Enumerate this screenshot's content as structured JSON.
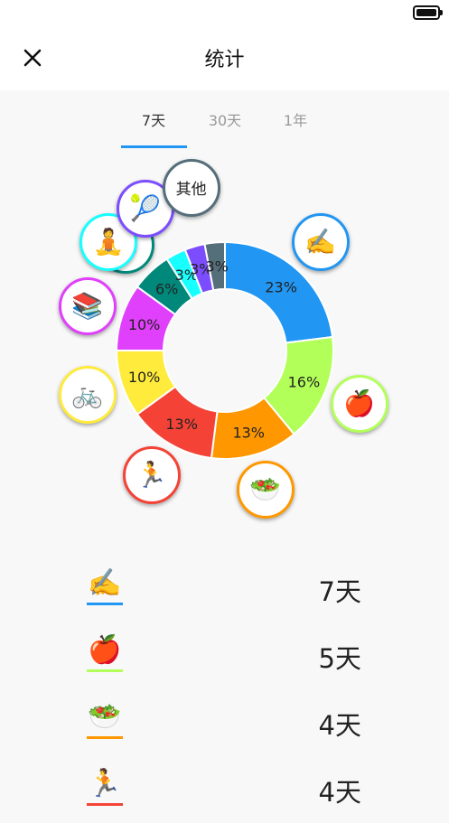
{
  "status": {
    "battery": "battery-full-icon"
  },
  "nav": {
    "title": "统计",
    "close_icon": "close-icon"
  },
  "tabs": [
    {
      "label": "7天",
      "active": true
    },
    {
      "label": "30天",
      "active": false
    },
    {
      "label": "1年",
      "active": false
    }
  ],
  "chart_data": {
    "type": "pie",
    "style": "donut",
    "slices": [
      {
        "label": "✍️",
        "value": 23,
        "text": "23%",
        "color": "#2196f3"
      },
      {
        "label": "🍎",
        "value": 16,
        "text": "16%",
        "color": "#b2ff59"
      },
      {
        "label": "🥗",
        "value": 13,
        "text": "13%",
        "color": "#ff9800"
      },
      {
        "label": "🏃",
        "value": 13,
        "text": "13%",
        "color": "#f44336"
      },
      {
        "label": "🚲",
        "value": 10,
        "text": "10%",
        "color": "#ffeb3b"
      },
      {
        "label": "📚",
        "value": 10,
        "text": "10%",
        "color": "#e040fb"
      },
      {
        "label": "🎵",
        "value": 6,
        "text": "6%",
        "color": "#00897b"
      },
      {
        "label": "🧘",
        "value": 3,
        "text": "3%",
        "color": "#18ffff"
      },
      {
        "label": "🎾",
        "value": 3,
        "text": "3%",
        "color": "#7c4dff"
      },
      {
        "label": "其他",
        "value": 3,
        "text": "3%",
        "color": "#546e7a"
      }
    ]
  },
  "list": [
    {
      "icon": "✍️",
      "icon_name": "writing-icon",
      "value": "7天",
      "color": "#2196f3"
    },
    {
      "icon": "🍎",
      "icon_name": "apple-icon",
      "value": "5天",
      "color": "#b2ff59"
    },
    {
      "icon": "🥗",
      "icon_name": "salad-icon",
      "value": "4天",
      "color": "#ff9800"
    },
    {
      "icon": "🏃",
      "icon_name": "running-icon",
      "value": "4天",
      "color": "#f44336"
    }
  ]
}
